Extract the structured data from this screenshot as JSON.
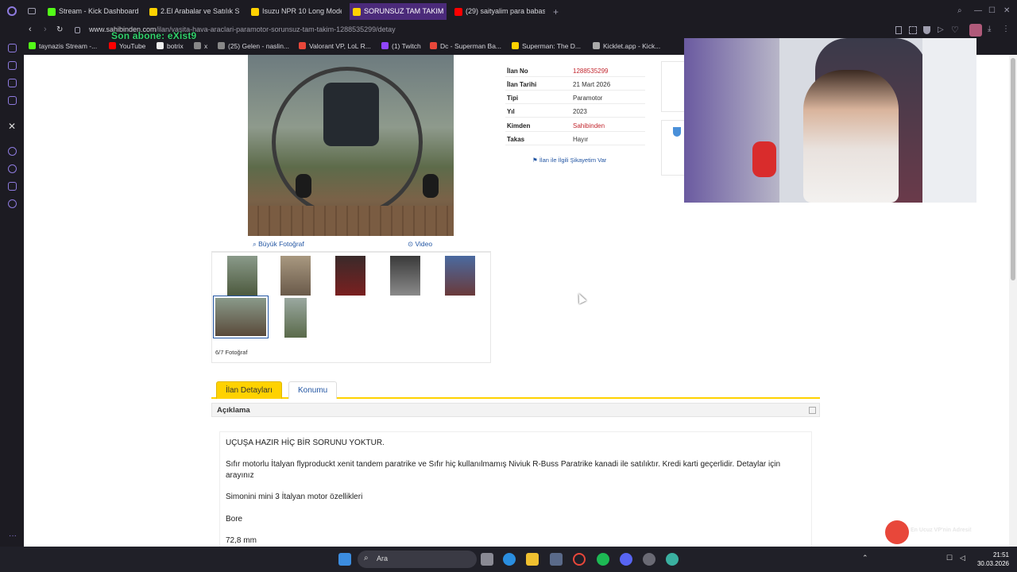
{
  "browser": {
    "tabs": [
      {
        "label": "Stream - Kick Dashboard",
        "color": "#53fc18"
      },
      {
        "label": "2.El Arabalar ve Satılık Sıfı",
        "color": "#ffd200"
      },
      {
        "label": "Isuzu NPR 10 Long Model",
        "color": "#ffd200"
      },
      {
        "label": "SORUNSUZ TAM TAKIM",
        "color": "#ffd200",
        "active": true
      },
      {
        "label": "(29) saityalim para babası",
        "color": "#ff0000"
      }
    ],
    "url_host": "www.sahibinden.com",
    "url_path": "/ilan/vasita-hava-araclari-paramotor-sorunsuz-tam-takim-1288535299/detay",
    "bookmarks": [
      {
        "label": "taynazis Stream -...",
        "color": "#53fc18"
      },
      {
        "label": "YouTube",
        "color": "#ff0000"
      },
      {
        "label": "botrix",
        "color": "#eeeeee"
      },
      {
        "label": "x",
        "color": "#eeeeee"
      },
      {
        "label": "(25) Gelen - naslin...",
        "color": "#eeeeee"
      },
      {
        "label": "Valorant VP, LoL R...",
        "color": "#e8473a"
      },
      {
        "label": "(1) Twitch",
        "color": "#9146ff"
      },
      {
        "label": "Dc - Superman Ba...",
        "color": "#e8473a"
      },
      {
        "label": "Superman: The D...",
        "color": "#ffd200"
      },
      {
        "label": "Kicklet.app - Kick...",
        "color": "#aaaaaa"
      }
    ],
    "overlay_subscriber": "Son abone: eXist9"
  },
  "listing": {
    "details": [
      {
        "key": "İlan No",
        "value": "1288535299",
        "red": true
      },
      {
        "key": "İlan Tarihi",
        "value": "21 Mart 2026",
        "red": false
      },
      {
        "key": "Tipi",
        "value": "Paramotor",
        "red": false
      },
      {
        "key": "Yıl",
        "value": "2023",
        "red": false
      },
      {
        "key": "Kimden",
        "value": "Sahibinden",
        "red": true
      },
      {
        "key": "Takas",
        "value": "Hayır",
        "red": false
      }
    ],
    "complaint_link": "İlan ile İlgili Şikayetim Var",
    "big_photo_link": "Büyük Fotoğraf",
    "video_link": "Video",
    "photo_count": "6/7 Fotoğraf",
    "tabs": [
      "İlan Detayları",
      "Konumu"
    ],
    "description_header": "Açıklama",
    "description": [
      "UÇUŞA HAZIR HİÇ BİR SORUNU YOKTUR.",
      "Sıfır motorlu İtalyan flyproduckt xenit tandem paratrike ve Sıfır hiç kullanılmamış Niviuk R-Buss Paratrike kanadi ile satılıktır. Kredi karti geçerlidir. Detaylar için arayınız",
      "Simonini mini 3 İtalyan motor özellikleri",
      "Bore",
      "72,8 mm"
    ]
  },
  "overlay": {
    "vpn_text": "En Ucuz VP'nin Adresi!"
  },
  "taskbar": {
    "search_placeholder": "Ara",
    "time": "21:51",
    "date": "30.03.2026"
  }
}
